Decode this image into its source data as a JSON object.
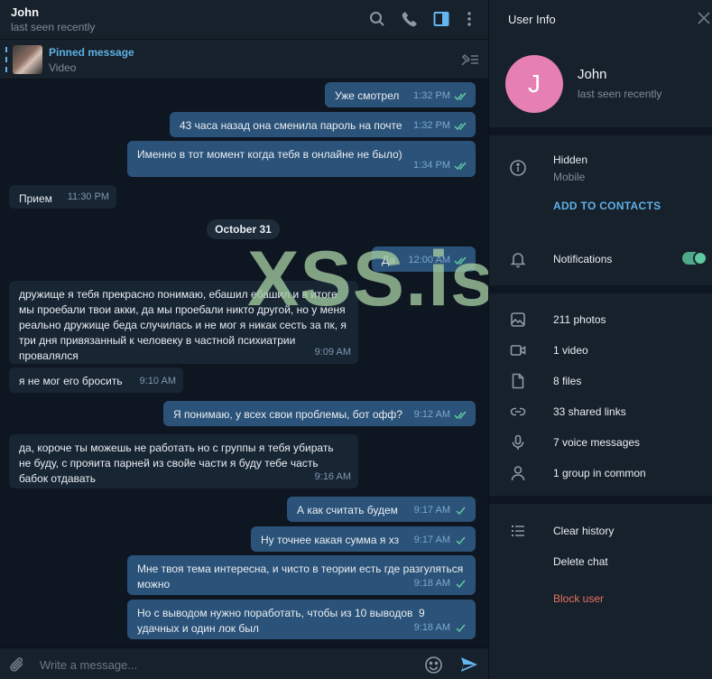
{
  "chat": {
    "name": "John",
    "status": "last seen recently",
    "pinned": {
      "title": "Pinned message",
      "subtitle": "Video"
    },
    "messages": [
      {
        "dir": "out",
        "text": "Уже смотрел",
        "time": "1:32 PM",
        "read": true
      },
      {
        "dir": "out",
        "text": "43 часа назад она сменила пароль на почте",
        "time": "1:32 PM",
        "read": true
      },
      {
        "dir": "out",
        "text": "Именно в тот момент когда тебя в онлайне не было)",
        "time": "1:34 PM",
        "read": true
      },
      {
        "dir": "in",
        "text": "Прием",
        "time": "11:30 PM"
      },
      {
        "dir": "out",
        "text": "Да",
        "time": "12:00 AM",
        "read": true
      },
      {
        "dir": "in",
        "text": "дружище я тебя прекрасно понимаю, ебашил ебашил и в итоге мы проебали твои акки, да мы проебали никто другой, но у меня реально дружище беда случилась и не мог я никак сесть за пк, я три дня привязанный к человеку в частной психиатрии провалялся",
        "time": "9:09 AM"
      },
      {
        "dir": "in",
        "text": "я не мог его бросить",
        "time": "9:10 AM"
      },
      {
        "dir": "out",
        "text": "Я понимаю, у всех свои проблемы, бот офф?",
        "time": "9:12 AM",
        "read": true
      },
      {
        "dir": "in",
        "text": "да, короче ты можешь не работать но с группы я тебя убирать не буду, с прояита парней из свойе части я буду тебе часть бабок отдавать",
        "time": "9:16 AM"
      },
      {
        "dir": "out",
        "text": "А как считать будем",
        "time": "9:17 AM",
        "read": false
      },
      {
        "dir": "out",
        "text": "Ну точнее какая сумма я хз",
        "time": "9:17 AM",
        "read": false
      },
      {
        "dir": "out",
        "text": "Мне твоя тема интересна, и чисто в теории есть где разгуляться можно",
        "time": "9:18 AM",
        "read": false
      },
      {
        "dir": "out",
        "text": "Но с выводом нужно поработать, чтобы из 10 выводов  9 удачных и один лок был",
        "time": "9:18 AM",
        "read": false
      }
    ],
    "date_separator": "October 31",
    "compose_placeholder": "Write a message...",
    "watermark": "XSS.is"
  },
  "panel": {
    "title": "User Info",
    "avatar_letter": "J",
    "avatar_color": "#e57fb4",
    "name": "John",
    "status": "last seen recently",
    "phone": "Hidden",
    "phone_label": "Mobile",
    "add_contact": "ADD TO CONTACTS",
    "notifications": "Notifications",
    "notifications_on": true,
    "media": [
      {
        "icon": "photo-icon",
        "label": "211 photos"
      },
      {
        "icon": "video-icon",
        "label": "1 video"
      },
      {
        "icon": "file-icon",
        "label": "8 files"
      },
      {
        "icon": "link-icon",
        "label": "33 shared links"
      },
      {
        "icon": "microphone-icon",
        "label": "7 voice messages"
      },
      {
        "icon": "user-icon",
        "label": "1 group in common"
      }
    ],
    "actions": {
      "clear": "Clear history",
      "delete": "Delete chat",
      "block": "Block user"
    }
  },
  "colors": {
    "accent": "#5fb0e5",
    "outgoing": "#2b5278",
    "incoming": "#182533",
    "danger": "#e8705f",
    "toggle": "#4fa889"
  }
}
